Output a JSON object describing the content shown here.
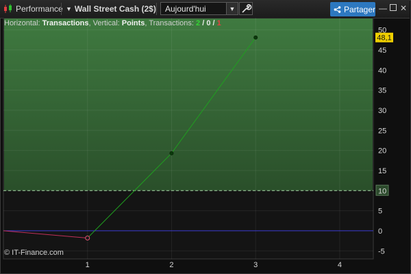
{
  "toolbar": {
    "app_label": "Performance",
    "instrument_label": "Wall Street Cash (2$)",
    "period_selected": "Aujourd'hui",
    "share_label": "Partager",
    "icons": [
      "candlestick-icon",
      "chevron-down-icon",
      "wrench-icon",
      "share-icon",
      "minimize-icon",
      "maximize-icon",
      "close-icon"
    ]
  },
  "header": {
    "prefix_horizontal": "Horizontal: ",
    "horizontal_value": "Transactions",
    "prefix_vertical": ", Vertical: ",
    "vertical_value": "Points",
    "prefix_transactions": ", Transactions: ",
    "winners": "2",
    "slash1": " / ",
    "neutral": "0",
    "slash2": " / ",
    "losers": "1"
  },
  "copyright": "© IT-Finance.com",
  "chart_data": {
    "type": "line",
    "x": [
      0,
      1,
      2,
      3
    ],
    "y": [
      0,
      -1.8,
      19.3,
      48.1
    ],
    "x_ticks": [
      1,
      2,
      3,
      4
    ],
    "y_ticks": [
      -5,
      0,
      5,
      10,
      15,
      20,
      25,
      30,
      35,
      40,
      45,
      50
    ],
    "xlim": [
      0,
      4.4
    ],
    "ylim": [
      -7,
      53
    ],
    "threshold_label": "10",
    "threshold": 10,
    "last_value_label": "48,1",
    "colors": {
      "up": "#1fa01f",
      "down": "#c0305a",
      "zero_line": "#3a3ad0",
      "positive_zone": "#3d6e3d",
      "threshold_line": "#a8d8a8",
      "last_value_bg": "#f0d000"
    }
  }
}
